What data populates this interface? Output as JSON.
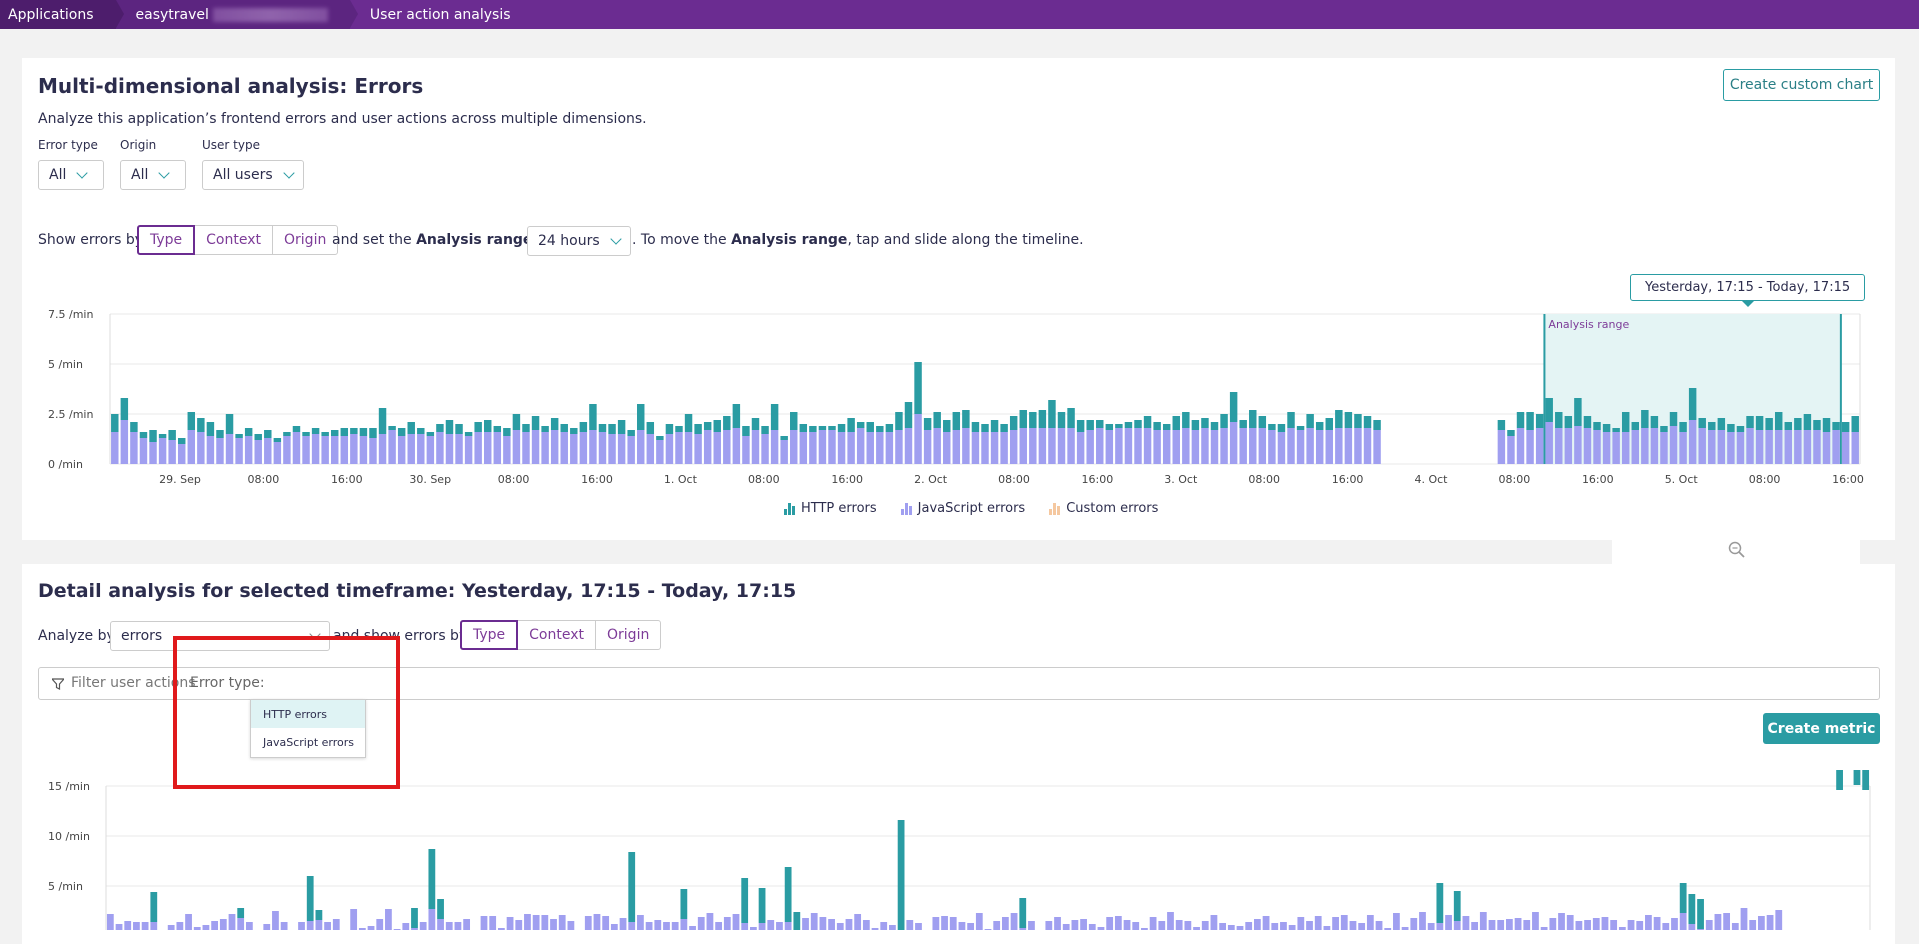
{
  "breadcrumb": {
    "items": [
      "Applications",
      "easytravel",
      "User action analysis"
    ]
  },
  "panel1": {
    "title": "Multi-dimensional analysis: Errors",
    "description": "Analyze this application’s frontend errors and user actions across multiple dimensions.",
    "create_chart_label": "Create custom chart",
    "filters": {
      "error_type": {
        "label": "Error type",
        "value": "All"
      },
      "origin": {
        "label": "Origin",
        "value": "All"
      },
      "user_type": {
        "label": "User type",
        "value": "All users"
      }
    },
    "show_by": {
      "prefix": "Show errors by",
      "options": [
        "Type",
        "Context",
        "Origin"
      ],
      "active": "Type"
    },
    "range_text_1": "and set the",
    "range_bold_1": "Analysis range",
    "range_text_2": "to",
    "range_value": "24 hours",
    "range_text_3": ". To move the",
    "range_bold_2": "Analysis range",
    "range_text_4": ", tap and slide along the timeline.",
    "tooltip": "Yesterday, 17:15 - Today, 17:15",
    "analysis_range_label": "Analysis range",
    "legend": [
      "HTTP errors",
      "JavaScript errors",
      "Custom errors"
    ]
  },
  "panel2": {
    "title": "Detail analysis for selected timeframe: Yesterday, 17:15 - Today, 17:15",
    "analyze_by_label": "Analyze by",
    "analyze_by_value": "errors",
    "show_by_prefix": "and show errors by",
    "show_by_options": [
      "Type",
      "Context",
      "Origin"
    ],
    "show_by_active": "Type",
    "filter_placeholder": "Filter user actions",
    "filter_token": "Error type:",
    "dropdown_options": [
      "HTTP errors",
      "JavaScript errors"
    ],
    "create_metric_label": "Create metric"
  },
  "colors": {
    "http": "#2a9ca3",
    "javascript": "#a09ff0",
    "custom": "#f5c8a0",
    "accent": "#6b2c91"
  },
  "chart_data": [
    {
      "type": "bar",
      "stacked": true,
      "y_ticks": [
        "7.5 /min",
        "5 /min",
        "2.5 /min",
        "0 /min"
      ],
      "ylim": [
        0,
        7.5
      ],
      "x_ticks": [
        "29. Sep",
        "08:00",
        "16:00",
        "30. Sep",
        "08:00",
        "16:00",
        "1. Oct",
        "08:00",
        "16:00",
        "2. Oct",
        "08:00",
        "16:00",
        "3. Oct",
        "08:00",
        "16:00",
        "4. Oct",
        "08:00",
        "16:00",
        "5. Oct",
        "08:00",
        "16:00"
      ],
      "series": [
        {
          "name": "HTTP errors",
          "values": [
            0.9,
            1.1,
            0.5,
            0.3,
            0.6,
            0.2,
            0.5,
            0.3,
            0.9,
            0.7,
            0.7,
            0.4,
            1.0,
            0.2,
            0.4,
            0.3,
            0.4,
            0.2,
            0.2,
            0.3,
            0.2,
            0.3,
            0.2,
            0.3,
            0.4,
            0.3,
            0.4,
            0.5,
            1.3,
            0.2,
            0.4,
            0.6,
            0.3,
            0.2,
            0.4,
            0.7,
            0.5,
            0.2,
            0.5,
            0.6,
            0.3,
            0.4,
            0.8,
            0.4,
            0.7,
            0.3,
            0.6,
            0.4,
            0.3,
            0.5,
            1.3,
            0.4,
            0.5,
            0.7,
            0.3,
            1.3,
            0.6,
            0.2,
            0.5,
            0.3,
            0.9,
            0.5,
            0.4,
            0.6,
            0.7,
            1.2,
            0.5,
            0.6,
            0.4,
            1.3,
            0.2,
            0.9,
            0.4,
            0.3,
            0.2,
            0.2,
            0.4,
            0.7,
            0.3,
            0.5,
            0.3,
            0.4,
            0.9,
            1.3,
            2.6,
            0.6,
            0.8,
            0.6,
            0.9,
            0.9,
            0.5,
            0.4,
            0.6,
            0.4,
            0.7,
            0.9,
            0.8,
            0.9,
            1.4,
            0.8,
            1.0,
            0.6,
            0.5,
            0.4,
            0.3,
            0.2,
            0.3,
            0.4,
            0.6,
            0.4,
            0.3,
            0.7,
            0.8,
            0.5,
            0.5,
            0.4,
            0.7,
            1.5,
            0.4,
            0.9,
            0.6,
            0.3,
            0.4,
            0.8,
            0.2,
            0.7,
            0.4,
            0.6,
            0.9,
            0.8,
            0.7,
            0.6,
            0.5,
            0,
            0,
            0,
            0,
            0,
            0,
            0,
            0,
            0,
            0,
            0,
            0,
            0.5,
            0.3,
            0.8,
            0.9,
            0.7,
            1.2,
            0.8,
            0.6,
            1.4,
            0.6,
            0.4,
            0.4,
            0.2,
            1.0,
            0.4,
            0.9,
            0.6,
            0.3,
            0.7,
            0.5,
            1.6,
            0.5,
            0.4,
            0.6,
            0.4,
            0.3,
            0.6,
            0.7,
            0.6,
            0.9,
            0.4,
            0.6,
            0.8,
            0.5,
            0.7,
            0.4,
            0.5,
            0.8
          ]
        },
        {
          "name": "JavaScript errors",
          "values": [
            1.6,
            2.2,
            1.6,
            1.3,
            1.1,
            1.3,
            1.2,
            1.0,
            1.7,
            1.6,
            1.4,
            1.3,
            1.5,
            1.3,
            1.4,
            1.2,
            1.3,
            1.1,
            1.4,
            1.6,
            1.4,
            1.5,
            1.4,
            1.4,
            1.4,
            1.5,
            1.4,
            1.3,
            1.5,
            1.7,
            1.4,
            1.5,
            1.5,
            1.4,
            1.6,
            1.5,
            1.5,
            1.4,
            1.6,
            1.6,
            1.6,
            1.4,
            1.7,
            1.6,
            1.7,
            1.6,
            1.7,
            1.6,
            1.5,
            1.6,
            1.7,
            1.6,
            1.5,
            1.5,
            1.4,
            1.7,
            1.5,
            1.2,
            1.5,
            1.6,
            1.6,
            1.5,
            1.7,
            1.6,
            1.7,
            1.8,
            1.4,
            1.7,
            1.5,
            1.7,
            1.2,
            1.7,
            1.6,
            1.6,
            1.7,
            1.7,
            1.6,
            1.6,
            1.8,
            1.6,
            1.6,
            1.6,
            1.7,
            1.8,
            2.5,
            1.7,
            1.8,
            1.6,
            1.7,
            1.8,
            1.6,
            1.6,
            1.6,
            1.6,
            1.7,
            1.8,
            1.8,
            1.8,
            1.8,
            1.8,
            1.8,
            1.6,
            1.7,
            1.8,
            1.7,
            1.8,
            1.8,
            1.8,
            1.8,
            1.7,
            1.7,
            1.7,
            1.8,
            1.7,
            1.8,
            1.7,
            1.8,
            2.1,
            1.8,
            1.8,
            1.8,
            1.7,
            1.6,
            1.8,
            1.7,
            1.8,
            1.7,
            1.7,
            1.8,
            1.8,
            1.8,
            1.8,
            1.7,
            0,
            0,
            0,
            0,
            0,
            0,
            0,
            0,
            0,
            0,
            0,
            0,
            1.7,
            1.4,
            1.8,
            1.7,
            1.8,
            2.1,
            1.8,
            1.8,
            1.9,
            1.8,
            1.7,
            1.6,
            1.6,
            1.6,
            1.7,
            1.8,
            1.8,
            1.6,
            1.9,
            1.6,
            2.2,
            1.8,
            1.7,
            1.7,
            1.6,
            1.6,
            1.8,
            1.7,
            1.7,
            1.7,
            1.7,
            1.7,
            1.7,
            1.7,
            1.6,
            1.7,
            1.6,
            1.6
          ]
        }
      ],
      "highlighted_range": {
        "start_index": 150,
        "end_index": 180
      }
    },
    {
      "type": "bar",
      "stacked": true,
      "y_ticks": [
        "15 /min",
        "10 /min",
        "5 /min"
      ],
      "ylim": [
        0,
        15
      ],
      "series": [
        {
          "name": "HTTP errors",
          "values": [
            0,
            0,
            0,
            0,
            0,
            3,
            0,
            0,
            0,
            0,
            0,
            0,
            0,
            0,
            0,
            1,
            0,
            0,
            0,
            0,
            0,
            0,
            0,
            4.5,
            1,
            0,
            0,
            0,
            0,
            0,
            0,
            0,
            0,
            0,
            0,
            2,
            0,
            6,
            2,
            0,
            0,
            0,
            0,
            0,
            0,
            0,
            0,
            0,
            0,
            0,
            0,
            0,
            0,
            0,
            0,
            0,
            0,
            0,
            0,
            0,
            7,
            0,
            0,
            0,
            0,
            0,
            3,
            0,
            0,
            0,
            0,
            0,
            0,
            4.5,
            0,
            3.5,
            0,
            0,
            5.5,
            2,
            0,
            0,
            0,
            0,
            0,
            0,
            0,
            0,
            0,
            0,
            0,
            11,
            0,
            0,
            0,
            0,
            0,
            0,
            0,
            0,
            0,
            0,
            0,
            0,
            0,
            3,
            0,
            0,
            0,
            0,
            0,
            0,
            0,
            0,
            0,
            0,
            0,
            0,
            0,
            0,
            0,
            0,
            0,
            0,
            0,
            0,
            0,
            0,
            0,
            0,
            0,
            0,
            0,
            0,
            0,
            0,
            0,
            0,
            0,
            0,
            0,
            0,
            0,
            0,
            0,
            0,
            0,
            0,
            0,
            0,
            0,
            0,
            0,
            4,
            0,
            3,
            0,
            0,
            0,
            0,
            0,
            0,
            0,
            0,
            0,
            0,
            0,
            0,
            0,
            0,
            0,
            0,
            0,
            0,
            0,
            0,
            0,
            0,
            0,
            0,
            0,
            3,
            3,
            3,
            0,
            0,
            0,
            0,
            0,
            0,
            0,
            0,
            0,
            0,
            0,
            0,
            0,
            0,
            0,
            2,
            0,
            1.5,
            2
          ]
        },
        {
          "name": "JavaScript errors",
          "values": [
            2.2,
            1.2,
            1.5,
            1.4,
            1.4,
            1.4,
            0.6,
            1.1,
            1.4,
            2.2,
            0.9,
            1.1,
            1.5,
            1.7,
            2.2,
            1.8,
            1.4,
            0.6,
            1.2,
            2.5,
            1.4,
            0.4,
            1.4,
            1.5,
            1.6,
            1.4,
            1.7,
            0.4,
            2.7,
            0.8,
            1.0,
            1.7,
            2.7,
            0.7,
            1.3,
            0.8,
            1.4,
            2.7,
            1.7,
            1.4,
            1.4,
            1.7,
            0.3,
            2.0,
            2.0,
            0.8,
            1.9,
            1.6,
            2.2,
            2.1,
            2.1,
            1.7,
            2.1,
            1.5,
            0.6,
            2.0,
            2.2,
            2.0,
            1.2,
            1.8,
            1.4,
            2.1,
            1.4,
            1.6,
            1.4,
            1.4,
            1.7,
            1.0,
            1.9,
            2.3,
            1.4,
            1.9,
            2.2,
            1.3,
            0.9,
            1.3,
            1.6,
            1.4,
            1.4,
            0.4,
            1.8,
            2.3,
            1.9,
            1.7,
            1.3,
            1.7,
            2.2,
            1.6,
            0.8,
            1.4,
            1.1,
            0.6,
            1.6,
            1.3,
            0.6,
            1.9,
            2.0,
            1.9,
            1.4,
            1.3,
            2.3,
            0.7,
            1.5,
            1.9,
            2.3,
            0.8,
            1.5,
            0.4,
            1.5,
            1.9,
            1.2,
            1.6,
            1.7,
            1.2,
            0.9,
            1.9,
            2.0,
            1.6,
            1.4,
            0.8,
            1.9,
            1.5,
            2.4,
            1.6,
            1.5,
            0.9,
            1.5,
            2.1,
            1.3,
            1.1,
            1.0,
            1.4,
            1.7,
            2.0,
            1.3,
            1.4,
            1.1,
            1.9,
            1.5,
            2.0,
            1.0,
            1.9,
            2.1,
            1.5,
            1.3,
            2.1,
            1.5,
            0.8,
            2.3,
            0.9,
            1.8,
            2.4,
            1.3,
            1.3,
            2.1,
            1.5,
            2.0,
            1.4,
            2.4,
            1.6,
            1.6,
            1.7,
            1.8,
            1.6,
            2.4,
            0.9,
            1.8,
            2.3,
            2.1,
            1.5,
            1.6,
            1.8,
            1.9,
            1.6,
            0.9,
            1.6,
            1.5,
            2.1,
            1.9,
            1.3,
            1.8,
            2.3,
            1.2,
            0.7,
            1.6,
            2.2,
            2.3,
            1.3,
            2.8,
            1.6,
            2.0,
            2.1,
            2.6
          ]
        }
      ]
    }
  ]
}
